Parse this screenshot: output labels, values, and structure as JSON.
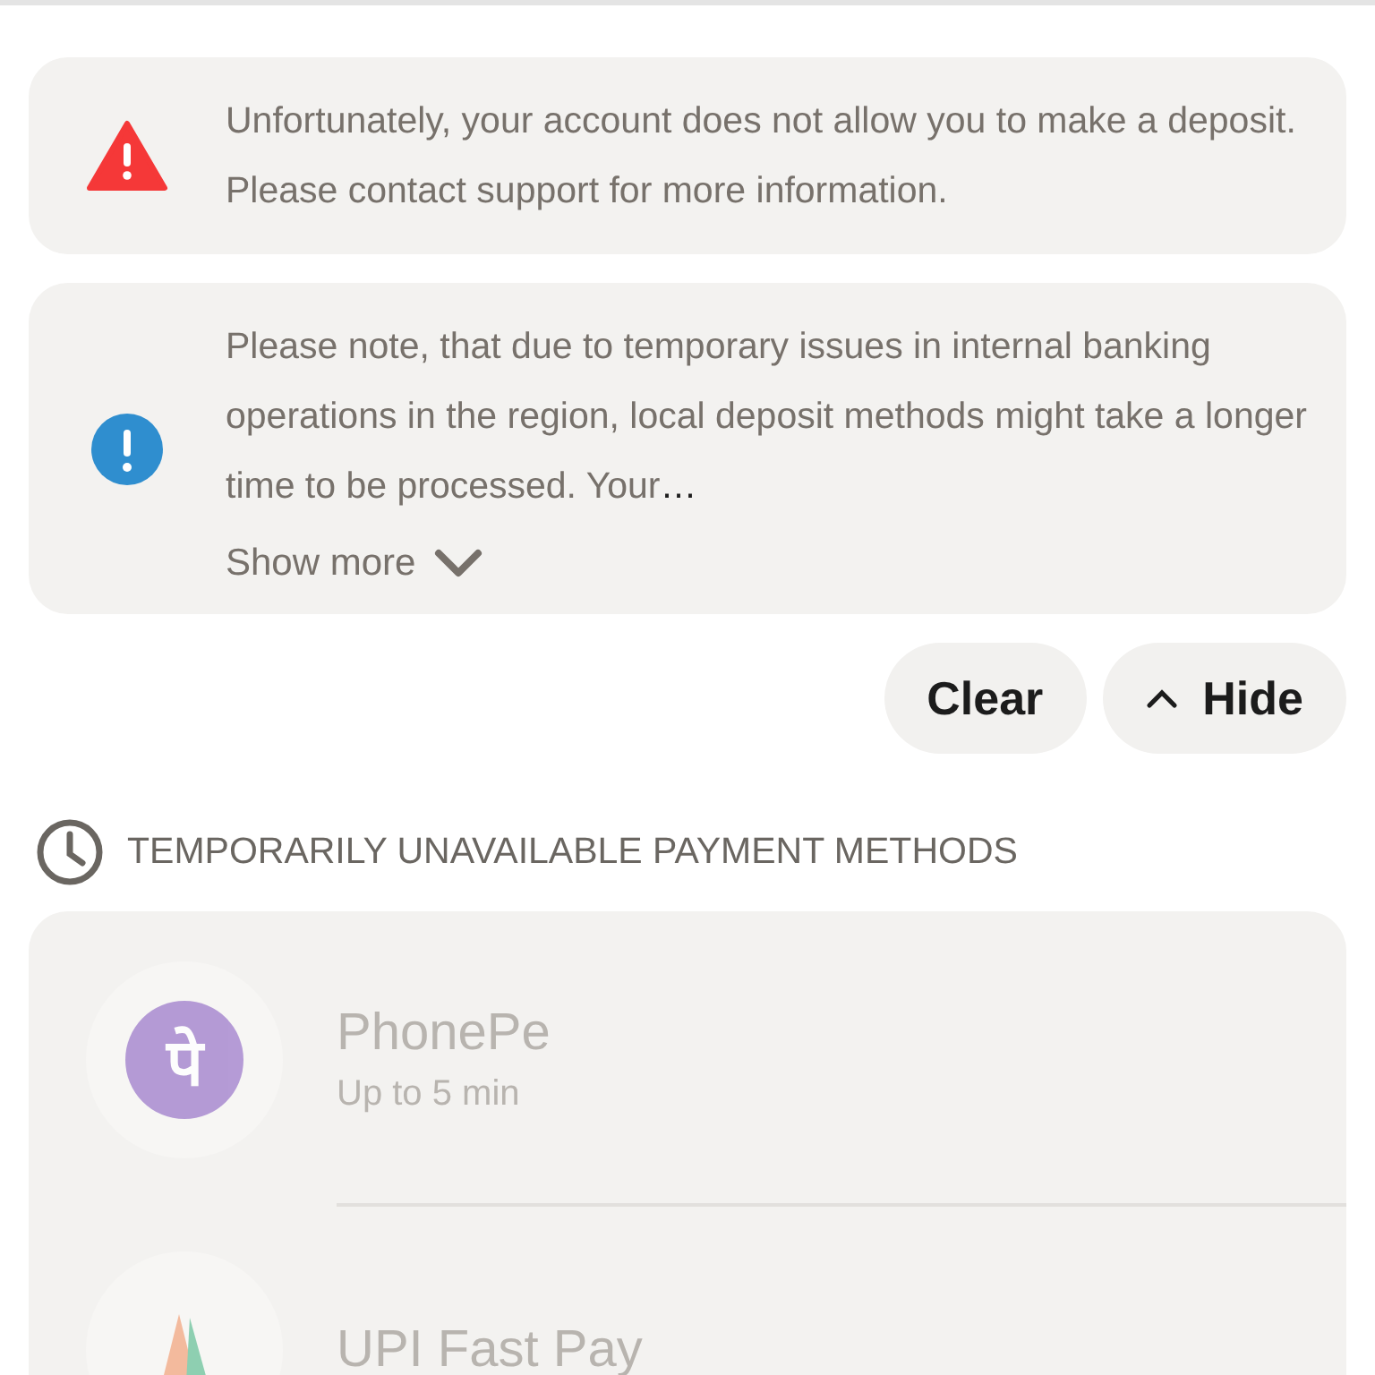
{
  "messages": [
    {
      "kind": "error",
      "text": "Unfortunately, your account does not allow you to make a deposit. Please contact support for more information."
    },
    {
      "kind": "info",
      "text": "Please note, that due to temporary issues in internal banking operations in the region, local deposit methods might take a longer time to be processed. Your",
      "ellipsis": "…",
      "toggle": {
        "label": "Show more",
        "expanded": false
      }
    }
  ],
  "actions": [
    {
      "kind": "clear",
      "label": "Clear"
    },
    {
      "kind": "hide",
      "label": "Hide"
    }
  ],
  "section": {
    "title": "TEMPORARILY UNAVAILABLE PAYMENT METHODS",
    "methods": [
      {
        "kind": "phonepe",
        "logo": "पे",
        "name": "PhonePe",
        "time": "Up to 5 min",
        "disabled": true
      },
      {
        "kind": "upi",
        "name": "UPI Fast Pay",
        "disabled": true
      }
    ]
  }
}
